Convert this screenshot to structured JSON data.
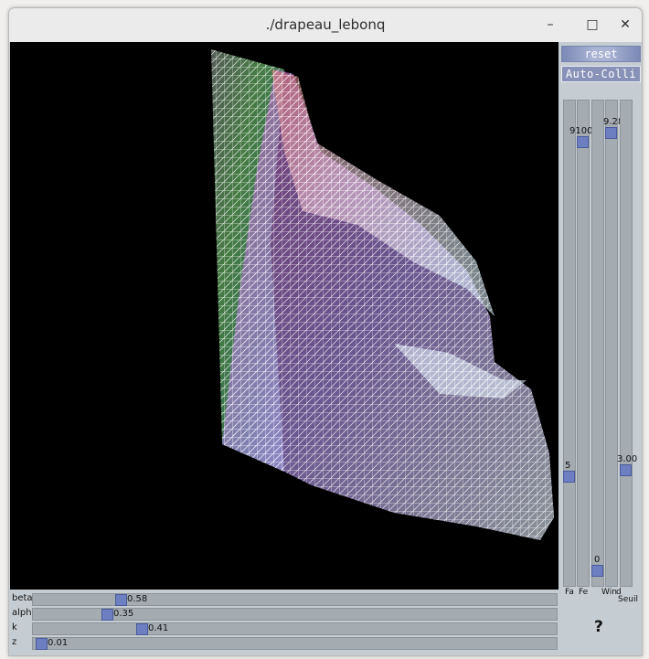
{
  "window": {
    "title": "./drapeau_lebonq"
  },
  "controls": {
    "minimize_glyph": "–",
    "maximize_glyph": "□",
    "close_glyph": "✕"
  },
  "buttons": {
    "reset": "reset",
    "auto_colli": "Auto-Colli"
  },
  "vertical_sliders": [
    {
      "label": "Fa",
      "value": "5"
    },
    {
      "label": "Fe",
      "value": "9100"
    },
    {
      "label": "Win",
      "value": "0"
    },
    {
      "label": "d",
      "value": "9.28"
    },
    {
      "label": "Seuil",
      "value": "3.00"
    }
  ],
  "horizontal_sliders": [
    {
      "label": "beta",
      "value": "0.58"
    },
    {
      "label": "alpha",
      "value": "0.35"
    },
    {
      "label": "k",
      "value": "0.41"
    },
    {
      "label": "z",
      "value": "0.01"
    }
  ],
  "help": {
    "label": "?"
  },
  "colors": {
    "panel": "#c6cdd2",
    "accent": "#6d7fc0",
    "track": "#a4acb2",
    "canvas": "#000000"
  },
  "icons": [
    "minimize-icon",
    "maximize-icon",
    "close-icon",
    "help-icon"
  ]
}
